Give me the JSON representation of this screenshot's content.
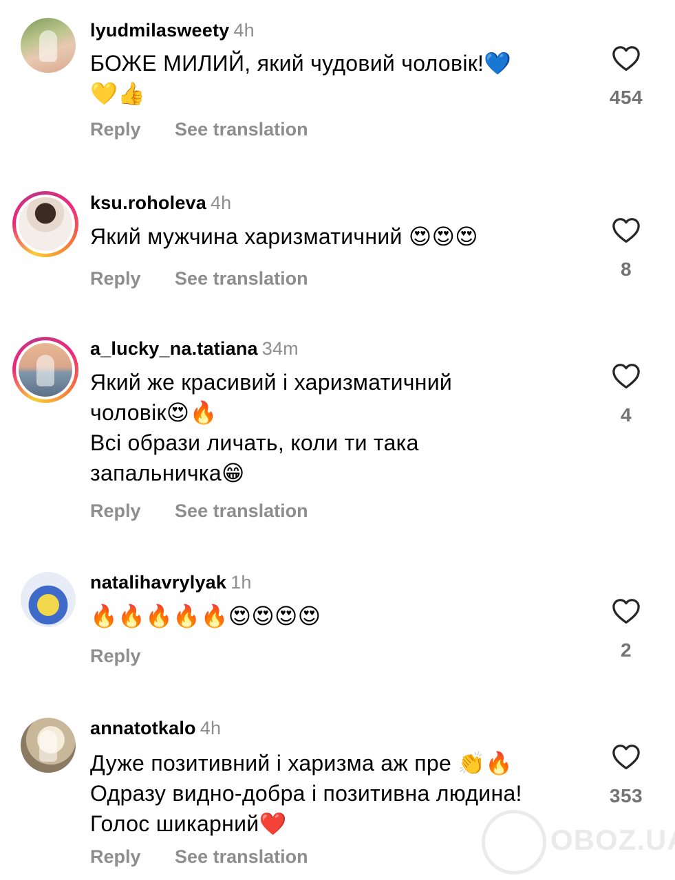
{
  "comments": [
    {
      "username": "lyudmilasweety",
      "time": "4h",
      "text": "БОЖЕ МИЛИЙ,  який чудовий чоловік!💙\n💛👍",
      "reply_label": "Reply",
      "translate_label": "See translation",
      "likes": "454",
      "avatar": "profile-photo"
    },
    {
      "username": "ksu.roholeva",
      "time": "4h",
      "text": "Який мужчина харизматичний 😍😍😍",
      "reply_label": "Reply",
      "translate_label": "See translation",
      "likes": "8",
      "avatar": "profile-photo-story-ring"
    },
    {
      "username": "a_lucky_na.tatiana",
      "time": "34m",
      "text": "Який же красивий і харизматичний\nчоловік😍🔥\nВсі образи личать, коли ти така\nзапальничка😁",
      "reply_label": "Reply",
      "translate_label": "See translation",
      "likes": "4",
      "avatar": "profile-photo-story-ring"
    },
    {
      "username": "natalihavrylyak",
      "time": "1h",
      "text": "🔥🔥🔥🔥🔥😍😍😍😍",
      "reply_label": "Reply",
      "likes": "2",
      "avatar": "profile-photo"
    },
    {
      "username": "annatotkalo",
      "time": "4h",
      "text": "Дуже позитивний і харизма аж пре 👏🔥\nОдразу видно-добра і позитивна людина!\nГолос шикарний❤️",
      "reply_label": "Reply",
      "translate_label": "See translation",
      "likes": "353",
      "avatar": "profile-photo"
    }
  ],
  "icons": {
    "like": "heart-outline-icon"
  },
  "watermark": {
    "text": "OBOZ.UA"
  }
}
